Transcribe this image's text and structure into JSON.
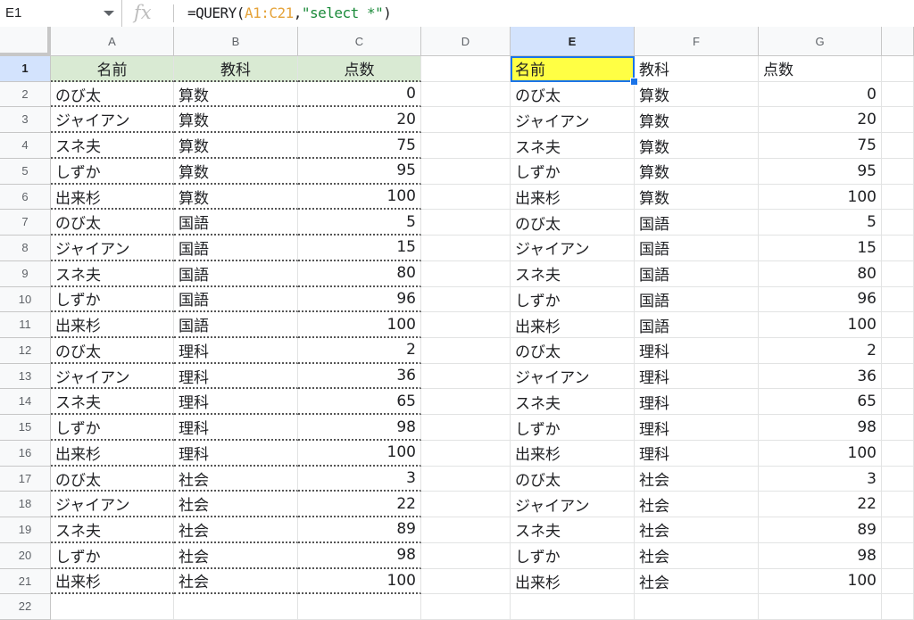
{
  "formula_bar": {
    "name_box": "E1",
    "fx": "fx",
    "formula_prefix": "=QUERY(",
    "formula_range": "A1:C21",
    "formula_comma": ",",
    "formula_string": "\"select *\"",
    "formula_suffix": ")"
  },
  "selected_cell": "E1",
  "columns": [
    "A",
    "B",
    "C",
    "D",
    "E",
    "F",
    "G"
  ],
  "rows": [
    "1",
    "2",
    "3",
    "4",
    "5",
    "6",
    "7",
    "8",
    "9",
    "10",
    "11",
    "12",
    "13",
    "14",
    "15",
    "16",
    "17",
    "18",
    "19",
    "20",
    "21",
    "22"
  ],
  "source_header": [
    "名前",
    "教科",
    "点数"
  ],
  "query_header": [
    "名前",
    "教科",
    "点数"
  ],
  "records": [
    [
      "のび太",
      "算数",
      "0"
    ],
    [
      "ジャイアン",
      "算数",
      "20"
    ],
    [
      "スネ夫",
      "算数",
      "75"
    ],
    [
      "しずか",
      "算数",
      "95"
    ],
    [
      "出来杉",
      "算数",
      "100"
    ],
    [
      "のび太",
      "国語",
      "5"
    ],
    [
      "ジャイアン",
      "国語",
      "15"
    ],
    [
      "スネ夫",
      "国語",
      "80"
    ],
    [
      "しずか",
      "国語",
      "96"
    ],
    [
      "出来杉",
      "国語",
      "100"
    ],
    [
      "のび太",
      "理科",
      "2"
    ],
    [
      "ジャイアン",
      "理科",
      "36"
    ],
    [
      "スネ夫",
      "理科",
      "65"
    ],
    [
      "しずか",
      "理科",
      "98"
    ],
    [
      "出来杉",
      "理科",
      "100"
    ],
    [
      "のび太",
      "社会",
      "3"
    ],
    [
      "ジャイアン",
      "社会",
      "22"
    ],
    [
      "スネ夫",
      "社会",
      "89"
    ],
    [
      "しずか",
      "社会",
      "98"
    ],
    [
      "出来杉",
      "社会",
      "100"
    ]
  ],
  "colors": {
    "header_fill": "#d9ead3",
    "selected_fill": "#ffff44",
    "selection_border": "#1a73e8",
    "range_color": "#e5a33a",
    "string_color": "#1b8a3a"
  }
}
